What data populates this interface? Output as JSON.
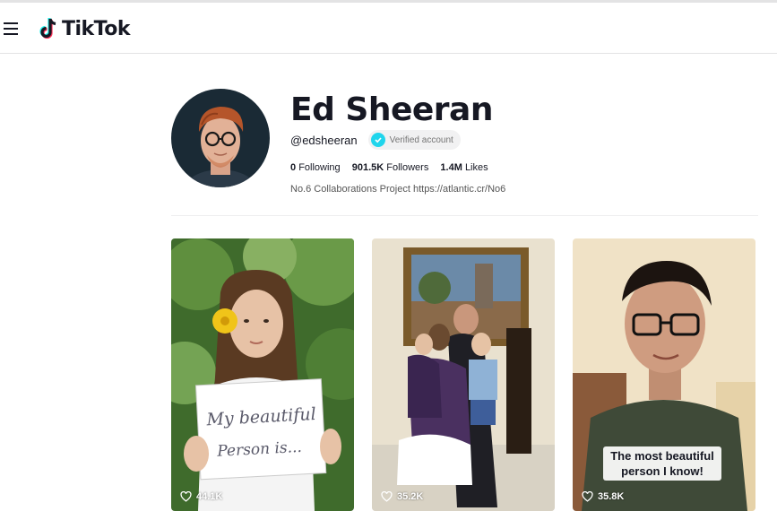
{
  "header": {
    "logo_text": "TikTok",
    "menu_icon": "hamburger-menu-icon"
  },
  "profile": {
    "name": "Ed Sheeran",
    "handle": "@edsheeran",
    "verified_label": "Verified account",
    "following_count": "0",
    "following_label": "Following",
    "followers_count": "901.5K",
    "followers_label": "Followers",
    "likes_count": "1.4M",
    "likes_label": "Likes",
    "bio": "No.6 Collaborations Project https://atlantic.cr/No6"
  },
  "videos": [
    {
      "views": "44.1K",
      "sign_text_line1": "My beautiful",
      "sign_text_line2": "Person is..."
    },
    {
      "views": "35.2K"
    },
    {
      "views": "35.8K",
      "caption": "The most beautiful person I know!"
    }
  ],
  "colors": {
    "verified_badge": "#20d5ec",
    "text_primary": "#161823",
    "text_secondary": "#555555"
  }
}
